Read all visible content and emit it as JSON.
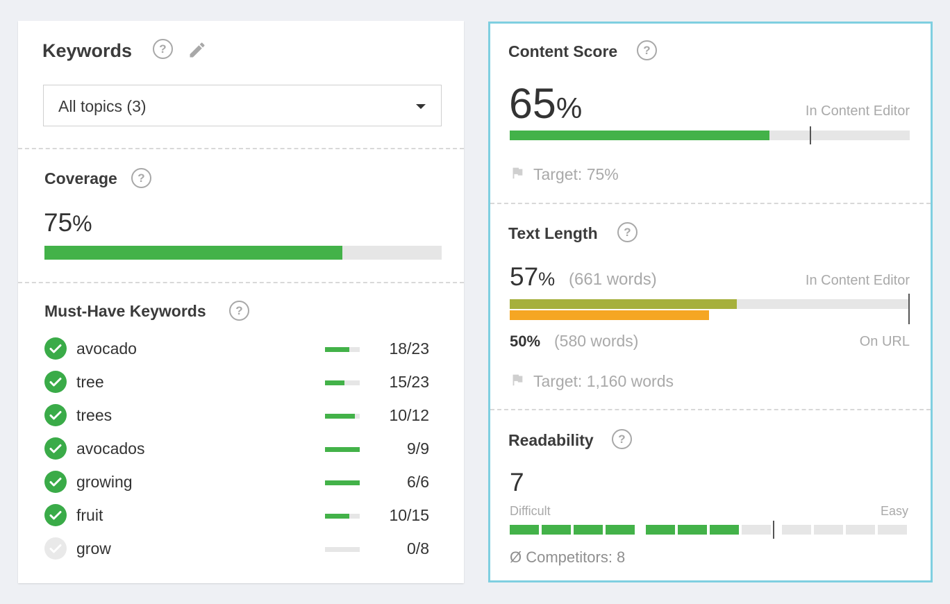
{
  "keywords": {
    "title": "Keywords",
    "help": "?",
    "dropdown_value": "All topics (3)",
    "coverage": {
      "title": "Coverage",
      "value": "75",
      "unit": "%",
      "fraction": 0.75
    },
    "must_have": {
      "title": "Must-Have Keywords",
      "items": [
        {
          "label": "avocado",
          "count": "18/23",
          "fraction": 0.7,
          "done": true
        },
        {
          "label": "tree",
          "count": "15/23",
          "fraction": 0.56,
          "done": true
        },
        {
          "label": "trees",
          "count": "10/12",
          "fraction": 0.86,
          "done": true
        },
        {
          "label": "avocados",
          "count": "9/9",
          "fraction": 1.0,
          "done": true
        },
        {
          "label": "growing",
          "count": "6/6",
          "fraction": 1.0,
          "done": true
        },
        {
          "label": "fruit",
          "count": "10/15",
          "fraction": 0.7,
          "done": true
        },
        {
          "label": "grow",
          "count": "0/8",
          "fraction": 0,
          "done": false
        }
      ]
    }
  },
  "content_score": {
    "title": "Content Score",
    "value": "65",
    "unit": "%",
    "caption": "In Content Editor",
    "fraction": 0.65,
    "target_fraction": 0.75,
    "target_text": "Target: 75%"
  },
  "text_length": {
    "title": "Text Length",
    "value": "57",
    "unit": "%",
    "words": "(661 words)",
    "caption": "In Content Editor",
    "editor_fraction": 0.57,
    "url_fraction": 0.5,
    "url_value": "50%",
    "url_words": "(580 words)",
    "url_caption": "On URL",
    "target_text": "Target: 1,160 words",
    "colors": {
      "editor": "#a6b03c",
      "url": "#f5a623"
    }
  },
  "readability": {
    "title": "Readability",
    "value": "7",
    "left_label": "Difficult",
    "right_label": "Easy",
    "competitors": "Ø Competitors: 8",
    "filled_segments": 7,
    "marker_after_segment": 8,
    "total_segments": 12
  },
  "colors": {
    "accent_green": "#43b249",
    "card_border": "#7fcfe0"
  }
}
